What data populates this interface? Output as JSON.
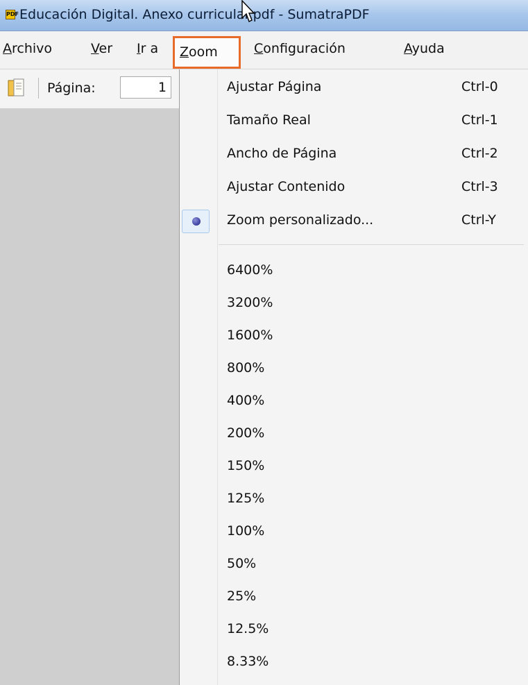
{
  "window": {
    "title": "Educación Digital. Anexo curricular.pdf - SumatraPDF",
    "app_icon": "sumatra-app-icon"
  },
  "menubar": [
    {
      "label": "Archivo",
      "mnemonic": "A",
      "rest": "rchivo"
    },
    {
      "label": "Ver",
      "mnemonic": "V",
      "rest": "er"
    },
    {
      "label": "Ir a",
      "mnemonic": "I",
      "rest": "r a"
    },
    {
      "label": "Zoom",
      "mnemonic": "Z",
      "rest": "oom",
      "active": true
    },
    {
      "label": "Configuración",
      "mnemonic": "C",
      "rest": "onfiguración"
    },
    {
      "label": "Ayuda",
      "mnemonic": "A",
      "rest": "yuda"
    }
  ],
  "toolbar": {
    "page_label": "Página:",
    "page_value": "1",
    "bookmark_icon": "book-icon"
  },
  "zoom_menu": {
    "items": [
      {
        "label": "Ajustar Página",
        "shortcut": "Ctrl-0"
      },
      {
        "label": "Tamaño Real",
        "shortcut": "Ctrl-1"
      },
      {
        "label": "Ancho de Página",
        "shortcut": "Ctrl-2"
      },
      {
        "label": "Ajustar Contenido",
        "shortcut": "Ctrl-3"
      },
      {
        "label": "Zoom personalizado...",
        "shortcut": "Ctrl-Y",
        "selected": true
      }
    ],
    "percentages": [
      "6400%",
      "3200%",
      "1600%",
      "800%",
      "400%",
      "200%",
      "150%",
      "125%",
      "100%",
      "50%",
      "25%",
      "12.5%",
      "8.33%"
    ]
  },
  "colors": {
    "highlight_border": "#e86b2b",
    "titlebar": "#a9c7ec",
    "doc_background": "#cfcfcf"
  }
}
